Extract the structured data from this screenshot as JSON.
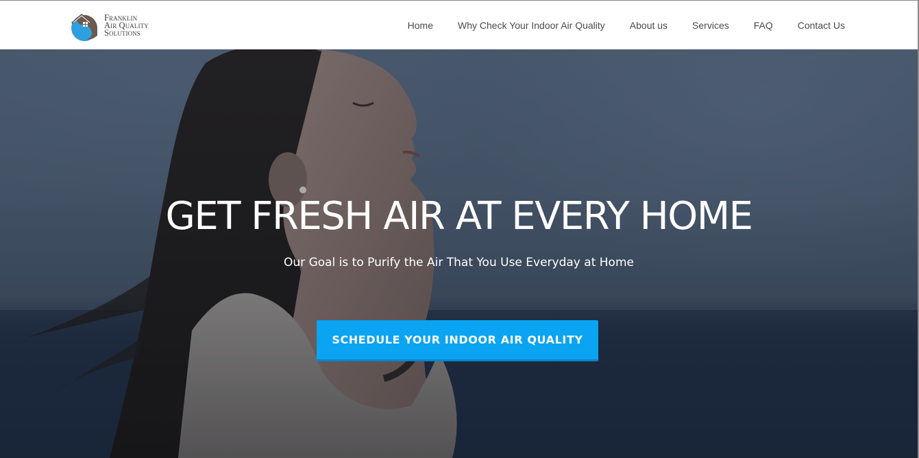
{
  "header": {
    "logo": {
      "lines": [
        "Franklin",
        "Air Quality",
        "Solutions"
      ],
      "icon": "house-drop-logo-icon"
    },
    "nav": [
      {
        "label": "Home"
      },
      {
        "label": "Why Check Your Indoor Air Quality"
      },
      {
        "label": "About us"
      },
      {
        "label": "Services"
      },
      {
        "label": "FAQ"
      },
      {
        "label": "Contact Us"
      }
    ]
  },
  "hero": {
    "title": "GET FRESH AIR AT EVERY HOME",
    "subtitle": "Our Goal is to Purify the Air That You Use Everyday at Home",
    "cta_label": "SCHEDULE YOUR INDOOR AIR QUALITY",
    "image": "woman-breathing-fresh-air-photo"
  },
  "colors": {
    "accent": "#0aa4f2",
    "nav_text": "#4a4a4a",
    "logo_blue": "#2f9fe0",
    "logo_brown": "#6b5a4e"
  }
}
